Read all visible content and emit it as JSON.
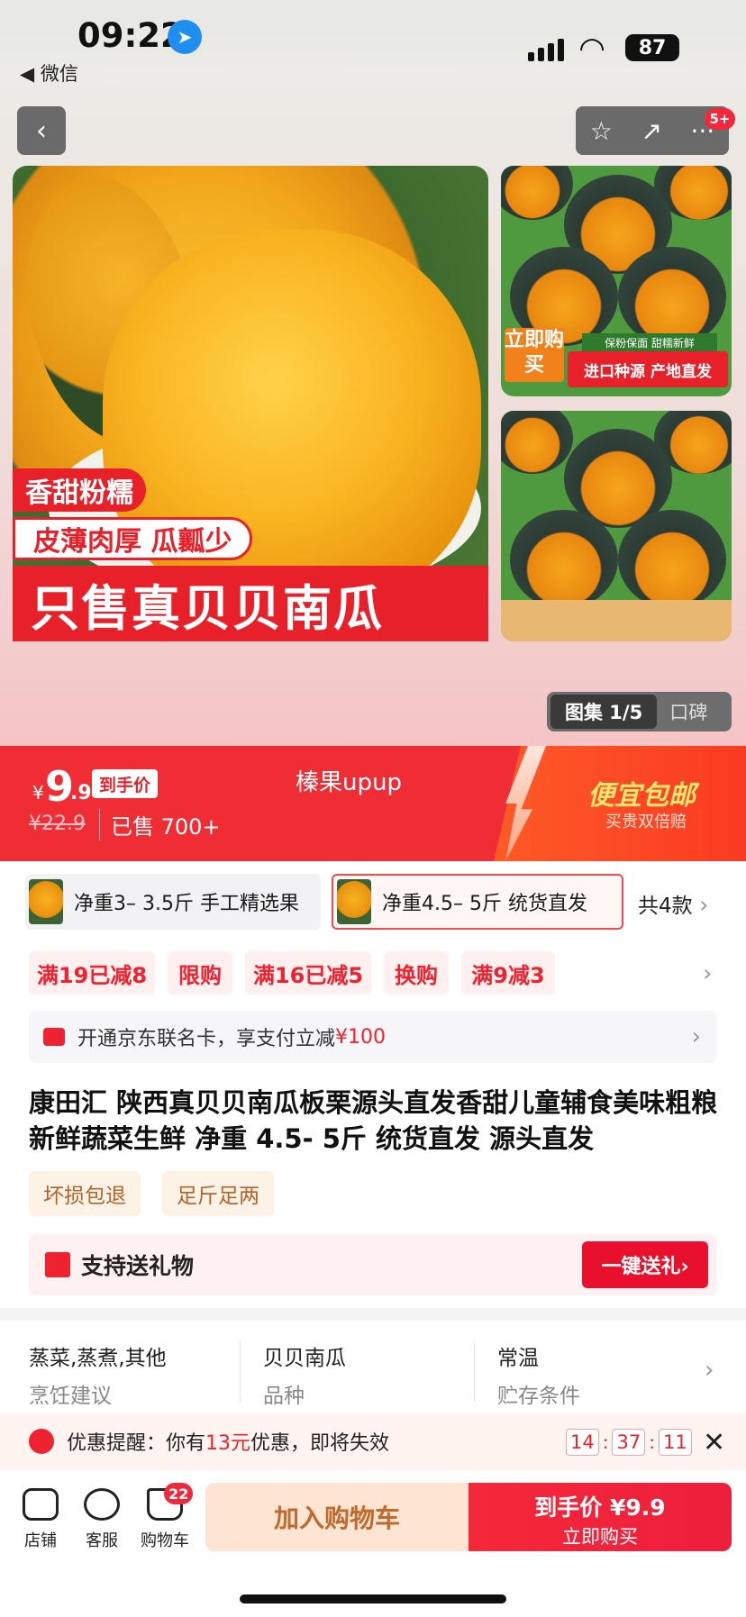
{
  "status": {
    "time": "09:22",
    "back_app": "◀ 微信",
    "battery": "87"
  },
  "nav": {
    "badge": "5+"
  },
  "images": {
    "main_tag1": "香甜粉糯",
    "main_tag2": "皮薄肉厚 瓜瓤少",
    "main_tag3": "只售真贝贝南瓜",
    "side_buy": "立即购买",
    "side_caption_small": "保粉保面 甜糯新鲜",
    "side_caption": "进口种源 产地直发"
  },
  "gallery": {
    "active": "图集 1/5",
    "other": "口碑"
  },
  "price": {
    "yen": "¥",
    "int": "9",
    "dec": ".9",
    "tag": "到手价",
    "old": "¥22.9",
    "sold": "已售 700+",
    "shop": "榛果upup",
    "promo": "便宜包邮",
    "promo_sub": "买贵双倍赔"
  },
  "variants": [
    {
      "label": "净重3– 3.5斤 手工精选果"
    },
    {
      "label": "净重4.5– 5斤 统货直发"
    }
  ],
  "variants_total": "共4款",
  "coupons": [
    "满19已减8",
    "限购",
    "满16已减5",
    "换购",
    "满9减3"
  ],
  "card": {
    "text": "开通京东联名卡，享支付立减",
    "amount": "¥100"
  },
  "title": "康田汇 陕西真贝贝南瓜板栗源头直发香甜儿童辅食美味粗粮新鲜蔬菜生鲜 净重 4.5- 5斤 统货直发 源头直发",
  "services": [
    "坏损包退",
    "足斤足两"
  ],
  "gift": {
    "text": "支持送礼物",
    "button": "一键送礼›"
  },
  "attributes": [
    {
      "value": "蒸菜,蒸煮,其他",
      "key": "烹饪建议"
    },
    {
      "value": "贝贝南瓜",
      "key": "品种"
    },
    {
      "value": "常温",
      "key": "贮存条件"
    }
  ],
  "reminder": {
    "prefix": "优惠提醒：你有",
    "amount": "13元",
    "suffix": "优惠，即将失效",
    "h": "14",
    "m": "37",
    "s": "11"
  },
  "bottom": {
    "store": "店铺",
    "service": "客服",
    "cart": "购物车",
    "cart_badge": "22",
    "add_cart": "加入购物车",
    "buy_line1": "到手价 ¥9.9",
    "buy_line2": "立即购买"
  }
}
